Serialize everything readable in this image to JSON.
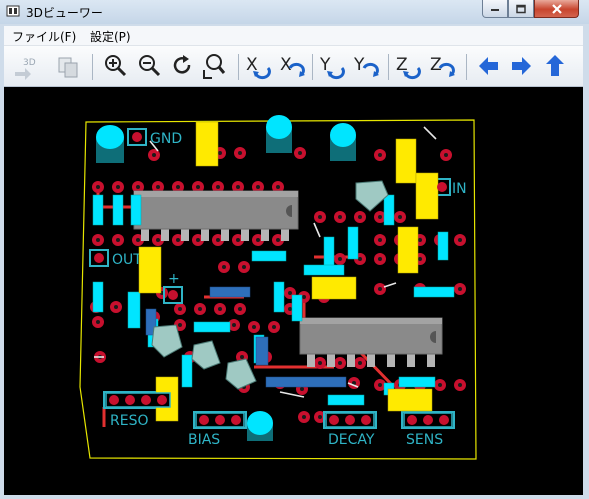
{
  "window": {
    "title": "3Dビューワー"
  },
  "menu": {
    "items": [
      "ファイル(F)",
      "設定(P)"
    ]
  },
  "toolbar": {
    "buttons": [
      {
        "name": "reload-3d-button",
        "label": "3D"
      },
      {
        "name": "copy-button",
        "label": ""
      },
      {
        "name": "zoom-in-button",
        "label": ""
      },
      {
        "name": "zoom-out-button",
        "label": ""
      },
      {
        "name": "redraw-button",
        "label": ""
      },
      {
        "name": "zoom-fit-button",
        "label": ""
      },
      {
        "name": "rotate-x-cw-button",
        "label": "X"
      },
      {
        "name": "rotate-x-ccw-button",
        "label": "X"
      },
      {
        "name": "rotate-y-cw-button",
        "label": "Y"
      },
      {
        "name": "rotate-y-ccw-button",
        "label": "Y"
      },
      {
        "name": "rotate-z-cw-button",
        "label": "Z"
      },
      {
        "name": "rotate-z-ccw-button",
        "label": "Z"
      },
      {
        "name": "move-left-button",
        "label": ""
      },
      {
        "name": "move-right-button",
        "label": ""
      },
      {
        "name": "move-up-button",
        "label": ""
      }
    ]
  },
  "board": {
    "labels": {
      "gnd": "GND",
      "in": "IN",
      "out": "OUT",
      "plus": "+",
      "reso": "RESO",
      "bias": "BIAS",
      "decay": "DECAY",
      "sens": "SENS"
    },
    "colors": {
      "silkscreen": "#2fb4c6",
      "pad": "#c8102e",
      "capacitor": "#ffea00",
      "resistor": "#00e5ff",
      "ic_body": "#8a8a8a",
      "outline": "#e6e600"
    }
  }
}
